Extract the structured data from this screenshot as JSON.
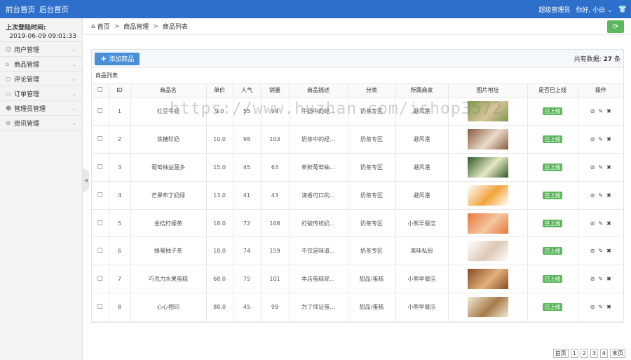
{
  "topbar": {
    "links": [
      "前台首页",
      "后台首页"
    ],
    "role": "超级管理员",
    "greeting": "你好, 小白",
    "greeting_chevron": "chevron-down-icon",
    "shirt_icon": "tshirt-icon"
  },
  "sidebar": {
    "login_label": "上次登陆时间:",
    "login_time": "2019-06-09 09:01:33",
    "items": [
      {
        "label": "用户管理",
        "icon": "user-icon"
      },
      {
        "label": "商品管理",
        "icon": "shop-icon"
      },
      {
        "label": "评论管理",
        "icon": "comment-icon"
      },
      {
        "label": "订单管理",
        "icon": "card-icon"
      },
      {
        "label": "管理员管理",
        "icon": "admin-icon"
      },
      {
        "label": "资讯管理",
        "icon": "gear-icon"
      }
    ]
  },
  "breadcrumb": [
    "首页",
    "商品管理",
    "商品列表"
  ],
  "toolbar": {
    "add_label": "添加商品",
    "total_prefix": "共有数据:",
    "total_count": "27",
    "total_unit": "条"
  },
  "list_caption": "商品列表",
  "table": {
    "headers": [
      "",
      "ID",
      "商品名",
      "单价",
      "人气",
      "销量",
      "商品描述",
      "分类",
      "所属商家",
      "图片地址",
      "是否已上线",
      "操作"
    ],
    "rows": [
      {
        "id": "1",
        "name": "红豆牛奶",
        "price": "9.0",
        "pop": "55",
        "sales": "94",
        "desc": "牛奶中的经...",
        "cat": "奶茶专区",
        "shop": "避风港",
        "img": [
          "#7a9b4a",
          "#d9c49a"
        ],
        "status": "已上线"
      },
      {
        "id": "2",
        "name": "焦糖珍奶",
        "price": "10.0",
        "pop": "98",
        "sales": "103",
        "desc": "奶茶中的经...",
        "cat": "奶茶专区",
        "shop": "避风港",
        "img": [
          "#8b5a3c",
          "#e8dccb"
        ],
        "status": "已上线"
      },
      {
        "id": "3",
        "name": "葡萄柚益菌多",
        "price": "15.0",
        "pop": "45",
        "sales": "63",
        "desc": "新鲜葡萄柚...",
        "cat": "奶茶专区",
        "shop": "避风港",
        "img": [
          "#2f5a2a",
          "#e6e8c2"
        ],
        "status": "已上线"
      },
      {
        "id": "4",
        "name": "芒果布丁奶绿",
        "price": "13.0",
        "pop": "41",
        "sales": "43",
        "desc": "清香可口的...",
        "cat": "奶茶专区",
        "shop": "避风港",
        "img": [
          "#ffffff",
          "#f2a33a"
        ],
        "status": "已上线"
      },
      {
        "id": "5",
        "name": "金桔柠檬茶",
        "price": "18.0",
        "pop": "72",
        "sales": "168",
        "desc": "打破传统奶...",
        "cat": "奶茶专区",
        "shop": "小熊早餐店",
        "img": [
          "#e8763a",
          "#f4c6a0"
        ],
        "status": "已上线"
      },
      {
        "id": "6",
        "name": "蜂蜜柚子茶",
        "price": "18.0",
        "pop": "74",
        "sales": "159",
        "desc": "不仅是味道...",
        "cat": "奶茶专区",
        "shop": "美味私厨",
        "img": [
          "#ffffff",
          "#dcc8b6"
        ],
        "status": "已上线"
      },
      {
        "id": "7",
        "name": "巧克力水果蛋糕",
        "price": "68.0",
        "pop": "75",
        "sales": "101",
        "desc": "本店蛋糕现...",
        "cat": "甜品/蛋糕",
        "shop": "小熊早餐店",
        "img": [
          "#8a4a24",
          "#e0b27a"
        ],
        "status": "已上线"
      },
      {
        "id": "8",
        "name": "心心相印",
        "price": "88.0",
        "pop": "45",
        "sales": "99",
        "desc": "为了保证蛋...",
        "cat": "甜品/蛋糕",
        "shop": "小熊早餐店",
        "img": [
          "#f4ead8",
          "#a87a4a"
        ],
        "status": "已上线"
      }
    ]
  },
  "watermark": "https://www.huzhan.com/ishop3572",
  "pager": [
    "首页",
    "1",
    "2",
    "3",
    "4",
    "末页"
  ]
}
